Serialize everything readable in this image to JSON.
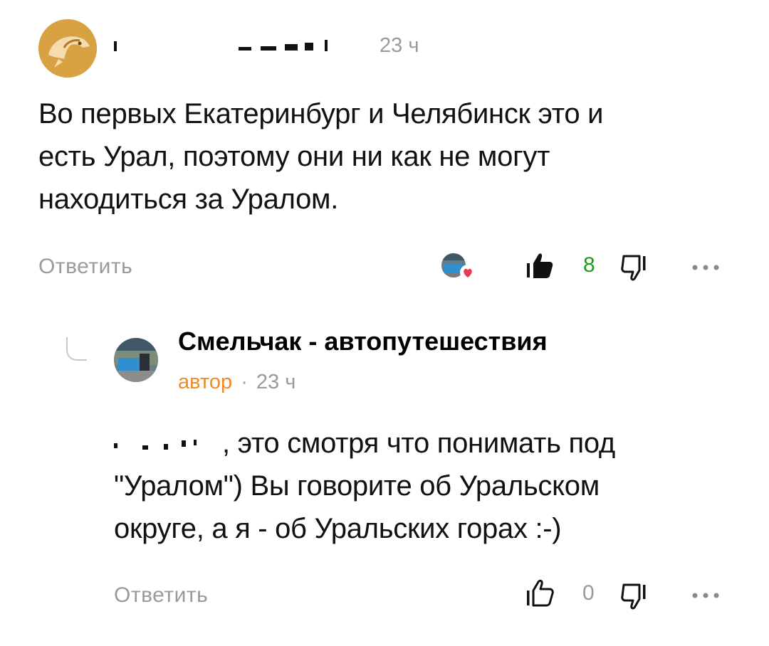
{
  "comment": {
    "author_name": "",
    "time": "23 ч",
    "text_lines": [
      "Во первых Екатеринбург и Челябинск это и",
      "есть Урал, поэтому они ни как не могут",
      "находиться за Уралом."
    ],
    "reply_label": "Ответить",
    "likes": "8",
    "colors": {
      "likes_count": "#1a9d1a"
    }
  },
  "reply": {
    "author_name": "Смельчак - автопутешествия",
    "author_badge": "автор",
    "separator": "·",
    "time": "23 ч",
    "text_lines": [
      ", это смотря что понимать под",
      "\"Уралом\") Вы говорите об Уральском",
      "округе, а я - об Уральских горах :-)"
    ],
    "reply_label": "Ответить",
    "likes": "0",
    "colors": {
      "badge": "#f08a24"
    }
  },
  "icons": {
    "commenter_avatar": "dolphin-avatar-icon",
    "liked_by_author": "author-liked-heart-icon",
    "like": "thumbs-up-icon",
    "dislike": "thumbs-down-icon",
    "more": "more-dots-icon",
    "thread": "thread-connector-icon"
  }
}
